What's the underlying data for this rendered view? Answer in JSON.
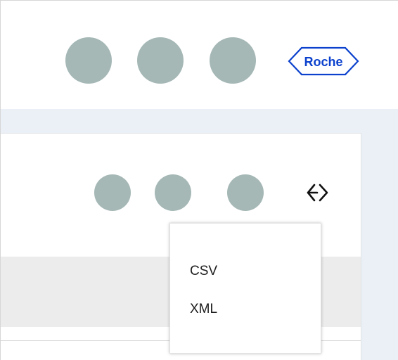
{
  "header": {
    "avatars": [
      "avatar-1",
      "avatar-2",
      "avatar-3"
    ],
    "logo": {
      "text": "Roche",
      "color": "#0b41cd"
    }
  },
  "toolbar": {
    "buttons": [
      "toolbar-button-1",
      "toolbar-button-2",
      "toolbar-button-3"
    ],
    "export_icon": "export-icon"
  },
  "export_menu": {
    "items": [
      {
        "label": "CSV"
      },
      {
        "label": "XML"
      }
    ]
  },
  "colors": {
    "avatar_gray": "#a5b8b6",
    "page_background": "#eaf0f6",
    "table_header": "#ececec",
    "brand_blue": "#0b41cd"
  }
}
